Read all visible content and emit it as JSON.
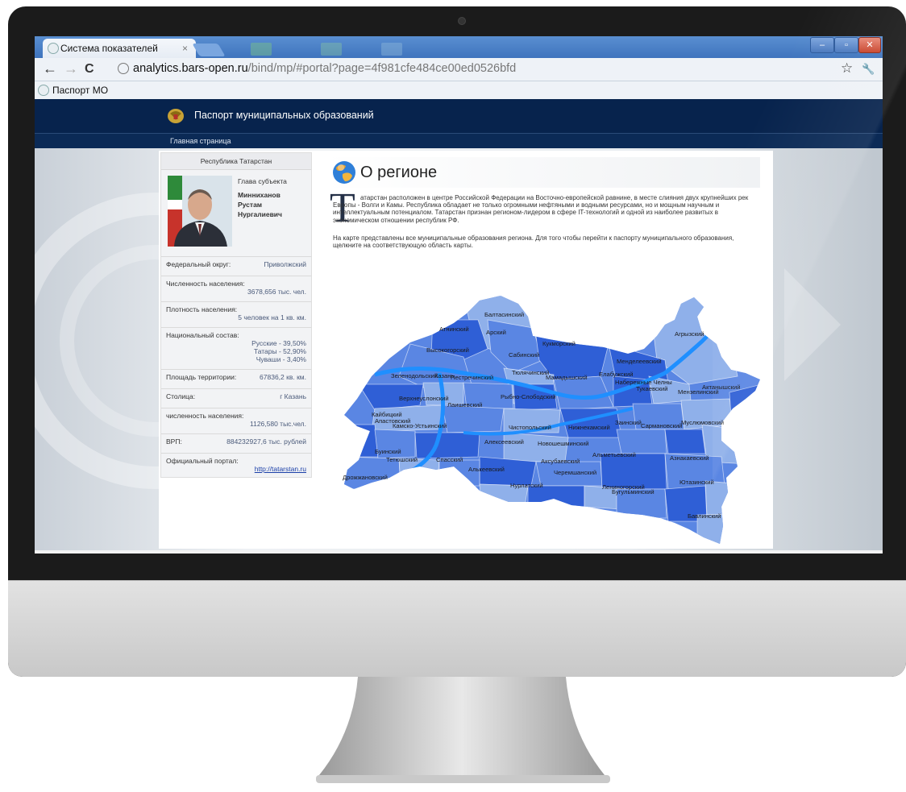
{
  "browser": {
    "tab_title": "Система показателей",
    "tab_close": "×",
    "url_host": "analytics.bars-open.ru",
    "url_path": "/bind/mp/#portal?page=4f981cfe484ce00ed0526bfd",
    "bookmark": "Паспорт МО",
    "back": "←",
    "forward": "→",
    "reload": "C",
    "star": "☆",
    "wrench": "🔧",
    "min": "–",
    "max": "▫",
    "close": "✕"
  },
  "site": {
    "title": "Паспорт муниципальных образований",
    "home_link": "Главная страница"
  },
  "side": {
    "header": "Республика Татарстан",
    "head_label": "Глава субъекта",
    "head_name": [
      "Минниханов",
      "Рустам",
      "Нургалиевич"
    ],
    "federal_label": "Федеральный округ:",
    "federal_value": "Приволжский",
    "population_label": "Численность населения:",
    "population_value": "3678,656 тыс. чел.",
    "density_label": "Плотность населения:",
    "density_value": "5 человек на 1 кв. км.",
    "ethnic_label": "Национальный состав:",
    "ethnic": [
      "Русские - 39,50%",
      "Татары - 52,90%",
      "Чуваши - 3,40%"
    ],
    "area_label": "Площадь территории:",
    "area_value": "67836,2 кв. км.",
    "capital_label": "Столица:",
    "capital_value": "г Казань",
    "cap_pop_label": "численность населения:",
    "cap_pop_value": "1126,580 тыс.чел.",
    "grp_label": "ВРП:",
    "grp_value": "884232927,6 тыс. рублей",
    "portal_label": "Официальный портал:",
    "portal_value": "http://tatarstan.ru"
  },
  "about": {
    "title": "О регионе",
    "dropcap": "Т",
    "para1": "атарстан расположен в центре Российской Федерации на Восточно-европейской равнине, в месте слияния двух крупнейших рек Европы - Волги и Камы. Республика обладает не только огромными нефтяными и водными ресурсами, но и мощным научным и интеллектуальным потенциалом. Татарстан признан регионом-лидером в сфере IT-технологий и одной из наиболее развитых в экономическом отношении республик РФ.",
    "para2": "На карте представлены все муниципальные образования региона. Для того чтобы перейти к паспорту муниципального образования, щелкните на соответствующую область карты."
  },
  "map": {
    "colors": {
      "dark": "#2f5fd6",
      "mid": "#5a86e3",
      "light": "#8fb0ea",
      "water": "#1f8fff"
    },
    "regions": [
      {
        "name": "Балтасинский"
      },
      {
        "name": "Атнинский"
      },
      {
        "name": "Арский"
      },
      {
        "name": "Кукморский"
      },
      {
        "name": "Агрызский"
      },
      {
        "name": "Высокогорский"
      },
      {
        "name": "Сабинский"
      },
      {
        "name": "Менделеевский"
      },
      {
        "name": "Зеленодольский"
      },
      {
        "name": "Казань"
      },
      {
        "name": "Пестречинский"
      },
      {
        "name": "Тюлячинский"
      },
      {
        "name": "Мамадышский"
      },
      {
        "name": "Елабужский"
      },
      {
        "name": "Набережные Челны"
      },
      {
        "name": "Тукаевский"
      },
      {
        "name": "Мензелинский"
      },
      {
        "name": "Актанышский"
      },
      {
        "name": "Верхнеуслонский"
      },
      {
        "name": "Лаишевский"
      },
      {
        "name": "Рыбно-Слободский"
      },
      {
        "name": "Кайбицкий"
      },
      {
        "name": "Апастовский"
      },
      {
        "name": "Камско-Устьинский"
      },
      {
        "name": "Нижнекамский"
      },
      {
        "name": "Заинский"
      },
      {
        "name": "Сармановский"
      },
      {
        "name": "Муслюмовский"
      },
      {
        "name": "Чистопольский"
      },
      {
        "name": "Алексеевский"
      },
      {
        "name": "Новошешминский"
      },
      {
        "name": "Буинский"
      },
      {
        "name": "Тетюшский"
      },
      {
        "name": "Спасский"
      },
      {
        "name": "Алькеевский"
      },
      {
        "name": "Аксубаевский"
      },
      {
        "name": "Альметьевский"
      },
      {
        "name": "Азнакаевский"
      },
      {
        "name": "Черемшанский"
      },
      {
        "name": "Дрожжановский"
      },
      {
        "name": "Нурлатский"
      },
      {
        "name": "Лениногорский"
      },
      {
        "name": "Бугульминский"
      },
      {
        "name": "Ютазинский"
      },
      {
        "name": "Бавлинский"
      }
    ]
  }
}
